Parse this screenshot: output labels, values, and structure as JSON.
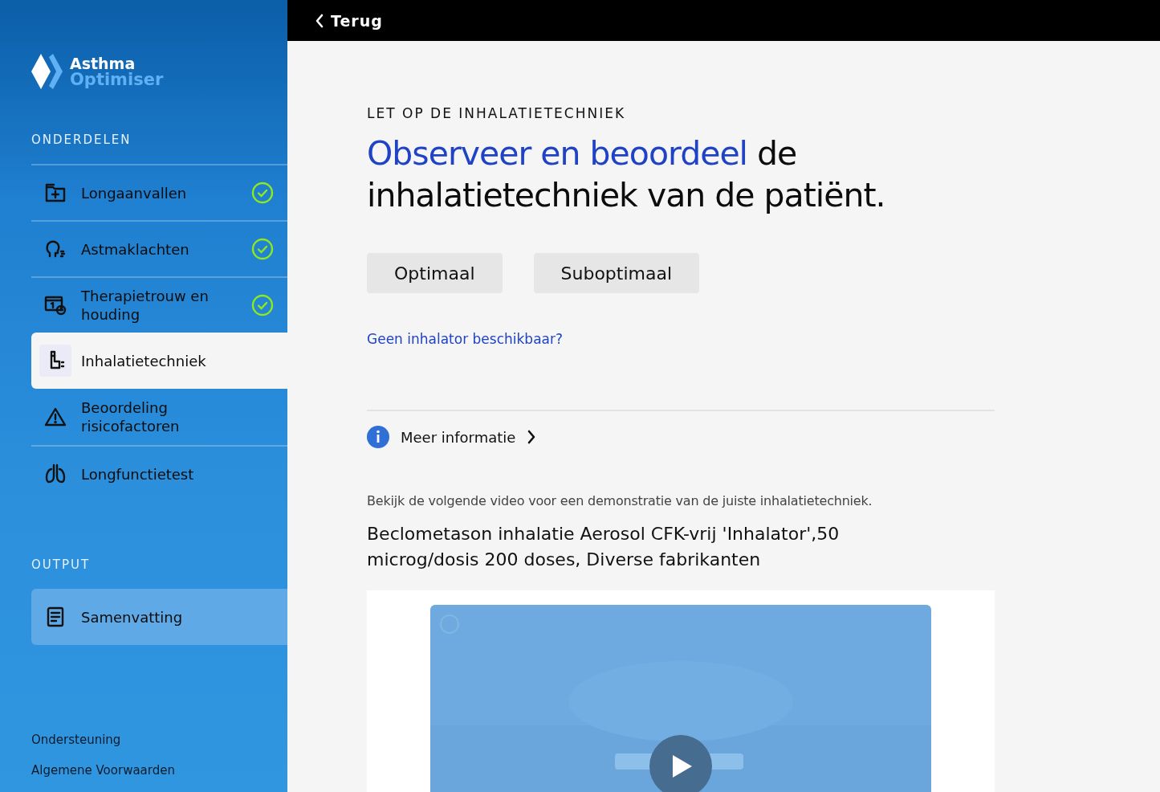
{
  "brand": {
    "line_1": "Asthma",
    "line_2": "Optimiser"
  },
  "sidebar": {
    "sections": [
      {
        "title": "ONDERDELEN",
        "items": [
          {
            "label": "Longaanvallen",
            "completed": true,
            "selected": false,
            "highlighted": false
          },
          {
            "label": "Astmaklachten",
            "completed": true,
            "selected": false,
            "highlighted": false
          },
          {
            "label": "Therapietrouw en houding",
            "completed": true,
            "selected": false,
            "highlighted": false
          },
          {
            "label": "Inhalatietechniek",
            "completed": false,
            "selected": true,
            "highlighted": false
          },
          {
            "label": "Beoordeling risicofactoren",
            "completed": false,
            "selected": false,
            "highlighted": false
          },
          {
            "label": "Longfunctietest",
            "completed": false,
            "selected": false,
            "highlighted": false
          }
        ]
      },
      {
        "title": "OUTPUT",
        "items": [
          {
            "label": "Samenvatting",
            "completed": false,
            "selected": false,
            "highlighted": true
          }
        ]
      }
    ],
    "footer_links": [
      "Ondersteuning",
      "Algemene Voorwaarden"
    ]
  },
  "top_bar": {
    "back_label": "Terug"
  },
  "content": {
    "eyebrow": "LET OP DE INHALATIETECHNIEK",
    "heading_accent": "Observeer en beoordeel",
    "heading_rest": "de inhalatietechniek van de patiënt.",
    "choices": [
      {
        "label": "Optimaal",
        "selected": false
      },
      {
        "label": "Suboptimaal",
        "selected": false
      }
    ],
    "link": "Geen inhalator beschikbaar?",
    "info_label": "Meer informatie",
    "intro": "Bekijk de volgende video voor een demonstratie van de juiste inhalatietechniek.",
    "product": "Beclometason inhalatie Aerosol CFK-vrij 'Inhalator',50 microg/dosis 200 doses, Diverse fabrikanten"
  }
}
